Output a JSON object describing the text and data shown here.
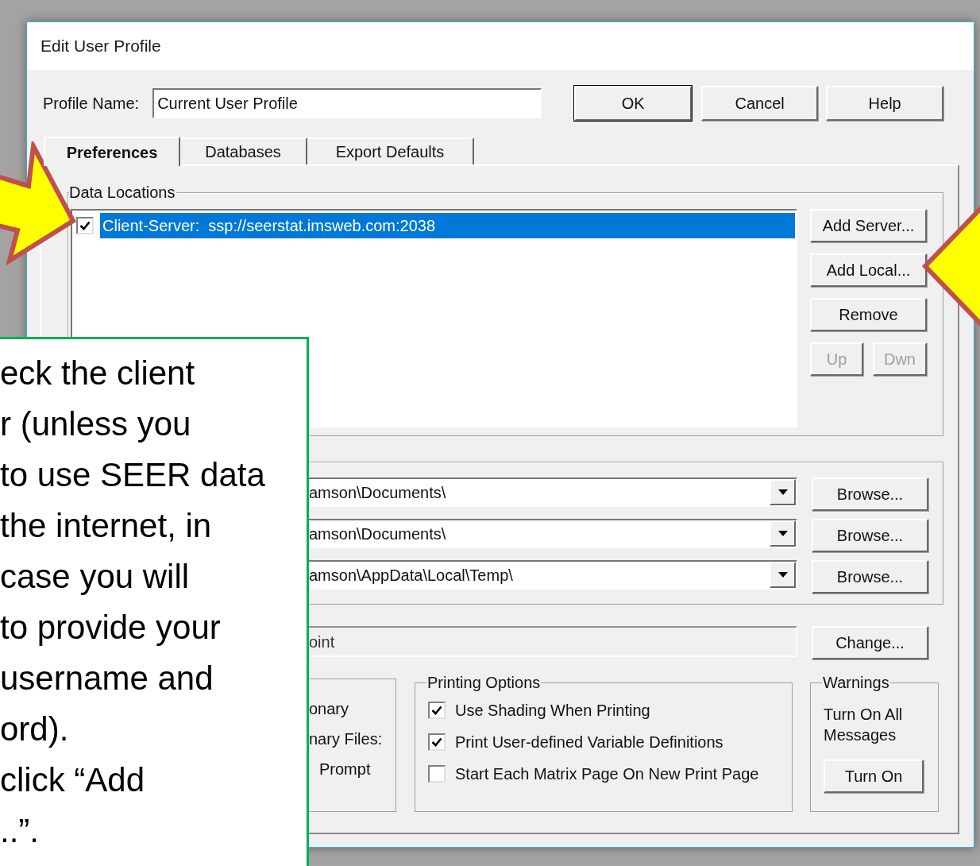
{
  "window": {
    "title": "Edit User Profile"
  },
  "profile_name": {
    "label": "Profile Name:",
    "value": "Current User Profile"
  },
  "dialog_buttons": [
    {
      "label": "OK",
      "default": true
    },
    {
      "label": "Cancel",
      "default": false
    },
    {
      "label": "Help",
      "default": false
    }
  ],
  "tabs": [
    {
      "label": "Preferences",
      "selected": true
    },
    {
      "label": "Databases",
      "selected": false
    },
    {
      "label": "Export Defaults",
      "selected": false
    }
  ],
  "data_locations": {
    "title": "Data Locations",
    "items": [
      {
        "label": "Client-Server:  ssp://seerstat.imsweb.com:2038",
        "checked": true,
        "selected": true
      }
    ],
    "buttons": [
      {
        "label": "Add Server...",
        "disabled": false
      },
      {
        "label": "Add Local...",
        "disabled": false
      },
      {
        "label": "Remove",
        "disabled": false
      },
      {
        "label": "Up",
        "disabled": true
      },
      {
        "label": "Dwn",
        "disabled": true
      }
    ]
  },
  "folders": [
    {
      "value": "amson\\Documents\\",
      "button": "Browse..."
    },
    {
      "value": "amson\\Documents\\",
      "button": "Browse..."
    },
    {
      "value": "amson\\AppData\\Local\\Temp\\",
      "button": "Browse..."
    }
  ],
  "printer": {
    "value": "oint",
    "button": "Change..."
  },
  "partial_group": {
    "lines": [
      "onary",
      "nary Files:",
      "Prompt"
    ]
  },
  "printing_options": {
    "title": "Printing Options",
    "items": [
      {
        "label": "Use Shading When Printing",
        "checked": true
      },
      {
        "label": "Print User-defined Variable Definitions",
        "checked": true
      },
      {
        "label": "Start Each Matrix Page On New Print Page",
        "checked": false
      }
    ]
  },
  "warnings": {
    "title": "Warnings",
    "text": "Turn On All Messages",
    "button": "Turn On"
  },
  "callout": {
    "lines": [
      "eck the client",
      "r (unless you",
      "to use SEER data",
      "the internet, in",
      "case you will",
      "to provide your",
      "username and",
      "ord).",
      "click “Add",
      "..”."
    ]
  }
}
